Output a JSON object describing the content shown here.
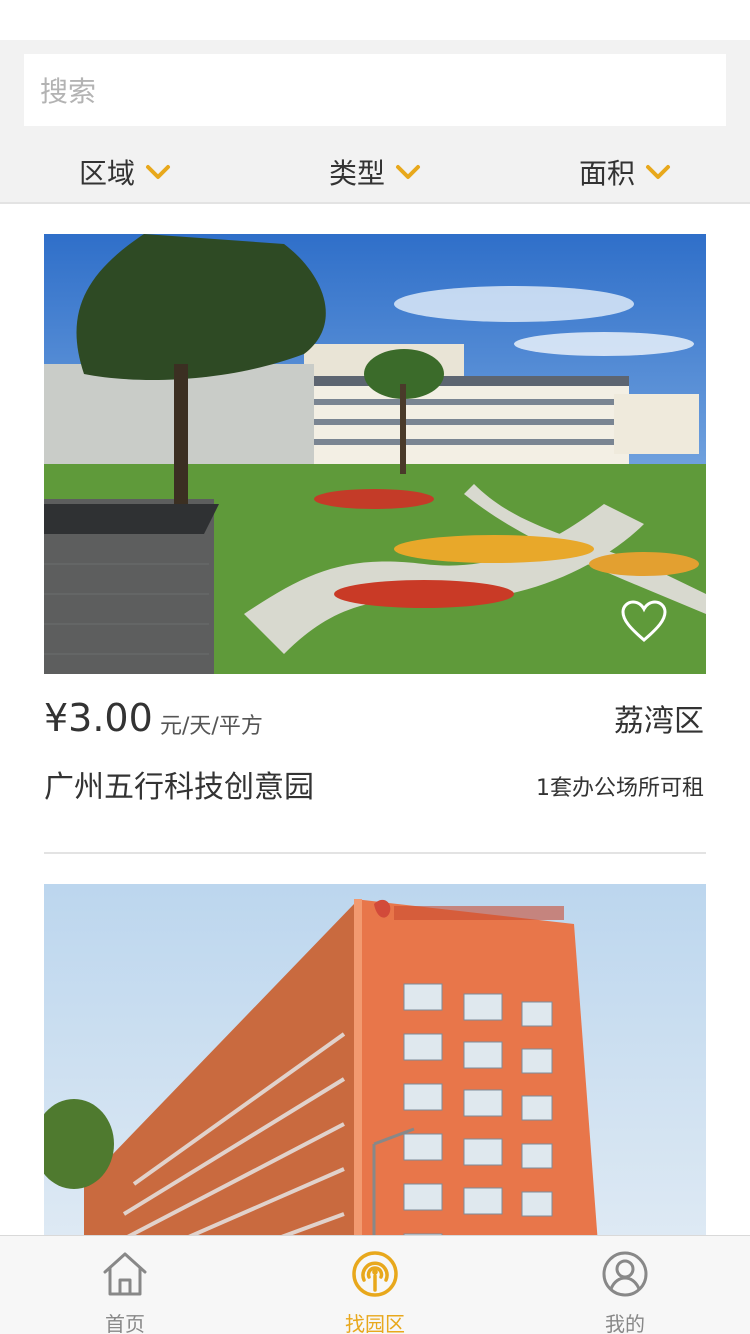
{
  "search": {
    "placeholder": "搜索"
  },
  "filters": [
    {
      "label": "区域"
    },
    {
      "label": "类型"
    },
    {
      "label": "面积"
    }
  ],
  "listings": [
    {
      "price": "¥3.00",
      "unit": "元/天/平方",
      "district": "荔湾区",
      "name": "广州五行科技创意园",
      "availability": "1套办公场所可租",
      "favorited": false
    },
    {
      "price": "",
      "unit": "",
      "district": "",
      "name": "",
      "availability": ""
    }
  ],
  "tabbar": {
    "items": [
      {
        "label": "首页",
        "icon": "home-icon",
        "active": false
      },
      {
        "label": "找园区",
        "icon": "broadcast-icon",
        "active": true
      },
      {
        "label": "我的",
        "icon": "user-icon",
        "active": false
      }
    ]
  },
  "colors": {
    "accent": "#e8a81c",
    "filter_bg": "#f2f2f2",
    "tab_inactive": "#888888"
  }
}
